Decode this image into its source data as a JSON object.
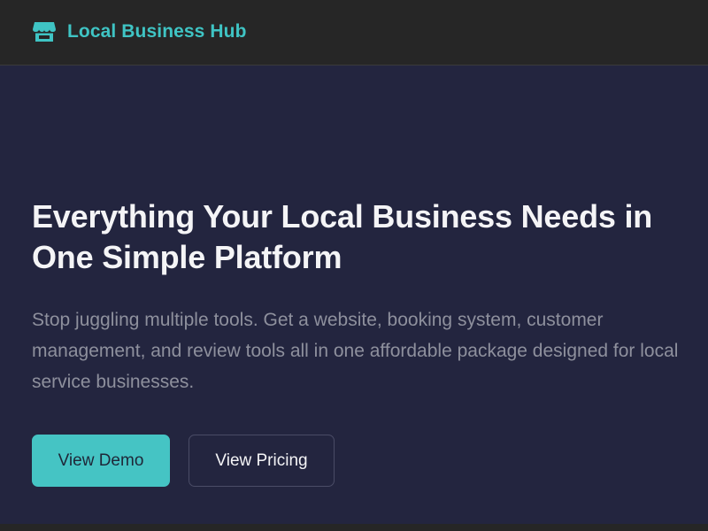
{
  "header": {
    "brand_name": "Local Business Hub",
    "brand_icon": "store-icon"
  },
  "hero": {
    "title": "Everything Your Local Business Needs in One Simple Platform",
    "subtitle": "Stop juggling multiple tools. Get a website, booking system, customer management, and review tools all in one affordable package designed for local service businesses.",
    "primary_button": "View Demo",
    "secondary_button": "View Pricing"
  },
  "colors": {
    "header_background": "#262626",
    "hero_background": "#23253f",
    "accent": "#45c4c4",
    "heading_text": "#f4f4f6",
    "body_text": "#8e909d"
  }
}
